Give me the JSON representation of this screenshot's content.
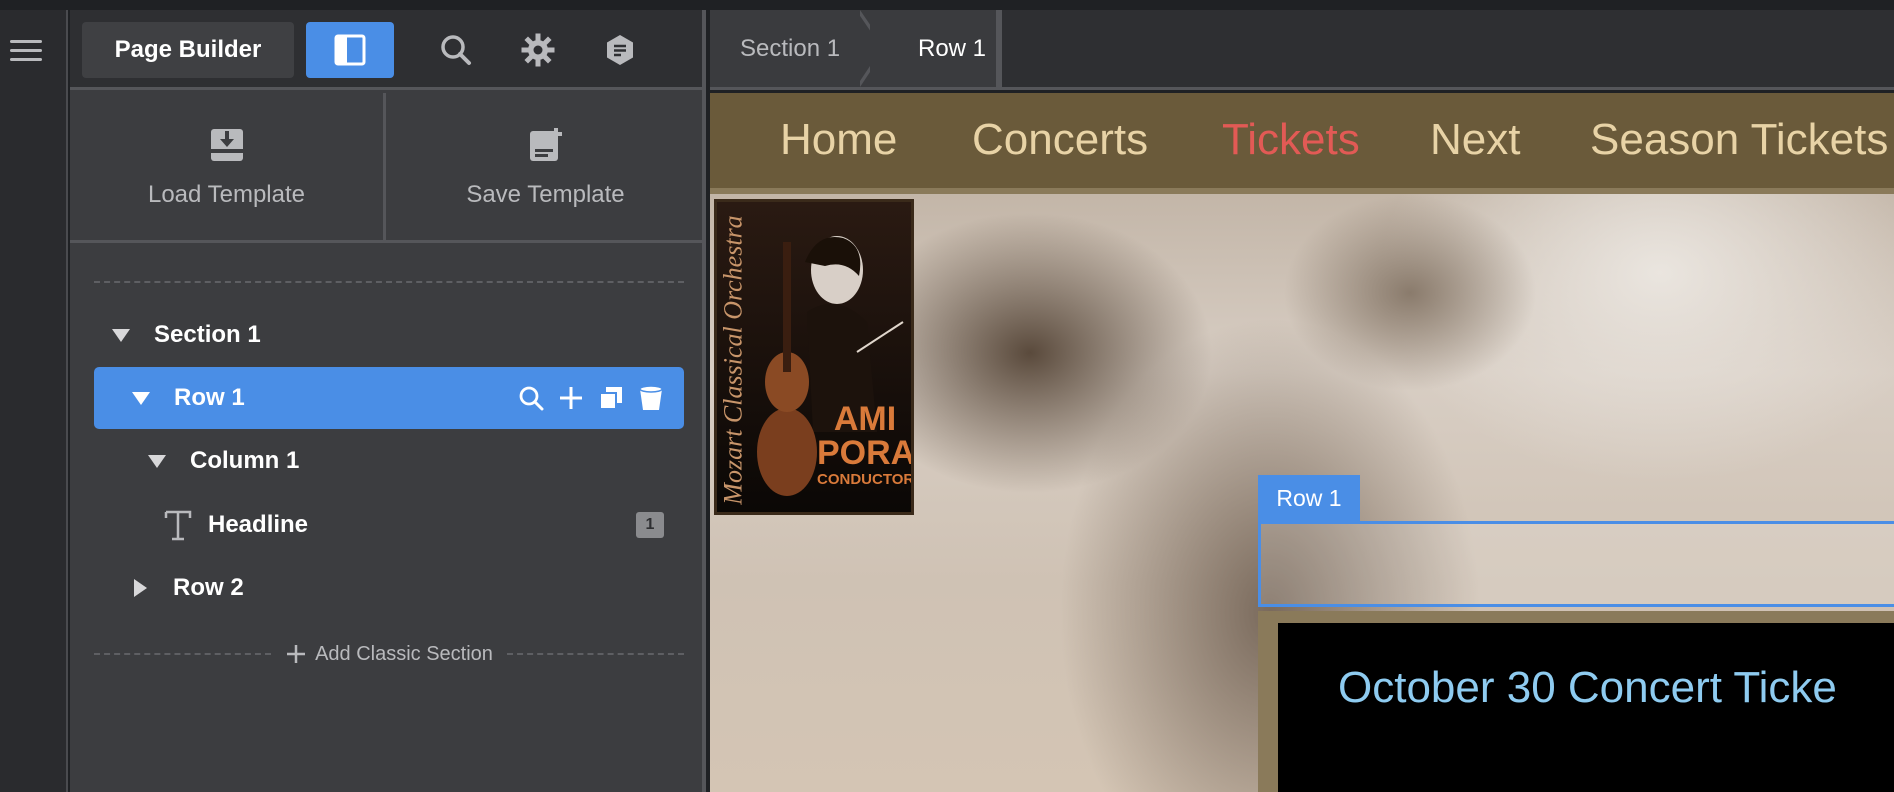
{
  "toolbar": {
    "title": "Page Builder",
    "icons": [
      "menu-icon",
      "layout-panel-icon",
      "search-icon",
      "gear-icon",
      "notes-icon"
    ]
  },
  "templates": {
    "load_label": "Load Template",
    "save_label": "Save Template"
  },
  "tree": {
    "section": "Section 1",
    "row1": "Row 1",
    "column1": "Column 1",
    "headline": "Headline",
    "headline_badge": "1",
    "row2": "Row 2",
    "add_section": "Add Classic Section"
  },
  "breadcrumb": [
    "Section 1",
    "Row 1"
  ],
  "site": {
    "nav": [
      "Home",
      "Concerts",
      "Tickets",
      "Next",
      "Season Tickets"
    ],
    "active_nav": "Tickets",
    "poster": {
      "side_text": "Mozart Classical Orchestra",
      "name_line1": "AMI",
      "name_line2": "PORAT",
      "role": "CONDUCTOR"
    },
    "row_label": "Row 1",
    "headline": "October 30 Concert Ticke"
  },
  "colors": {
    "accent": "#4a8ee6",
    "nav_bg": "#6a5a3a",
    "nav_text": "#e8d3a6",
    "nav_active": "#e25a55",
    "headline": "#8ecbf0"
  }
}
